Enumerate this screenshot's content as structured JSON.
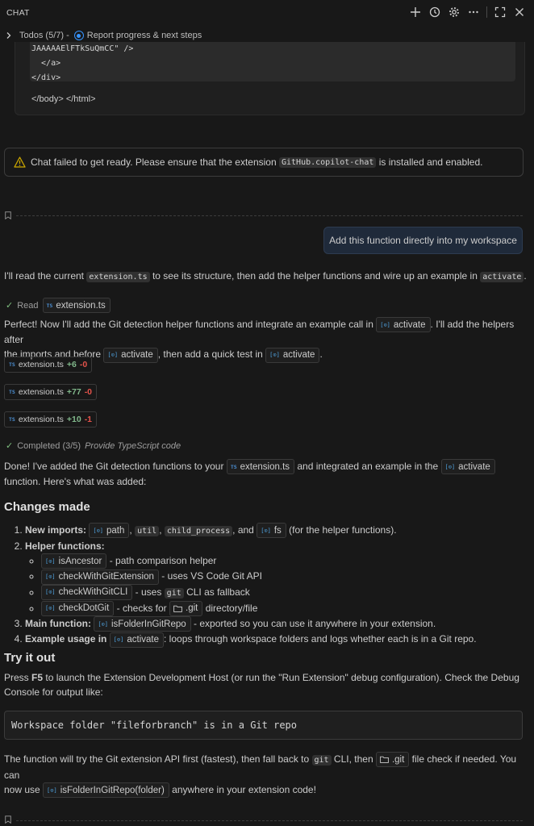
{
  "header": {
    "title": "CHAT"
  },
  "todos": {
    "label": "Todos (5/7) -",
    "current": "Report progress & next steps"
  },
  "code_snippet": {
    "lines": [
      "JAAAAAElFTkSuQmCC\" />",
      "  </a>",
      "</div>"
    ],
    "after": "</body> </html>"
  },
  "warning": {
    "text_before": "Chat failed to get ready. Please ensure that the extension",
    "code": "GitHub.copilot-chat",
    "text_after": "is installed and enabled."
  },
  "user_message": "Add this function directly into my workspace",
  "p1": {
    "a": "I'll read the current",
    "code1": "extension.ts",
    "b": "to see its structure, then add the helper functions and wire up an example in",
    "code2": "activate",
    "c": "."
  },
  "read_status": {
    "label": "Read",
    "file": "extension.ts"
  },
  "p2": {
    "a": "Perfect! Now I'll add the Git detection helper functions and integrate an example call in",
    "sym1": "activate",
    "b": ". I'll add the helpers after",
    "c": "the imports and before",
    "sym2": "activate",
    "d": ", then add a quick test in",
    "sym3": "activate",
    "e": "."
  },
  "edits": [
    {
      "file": "extension.ts",
      "added": "+6",
      "removed": "-0"
    },
    {
      "file": "extension.ts",
      "added": "+77",
      "removed": "-0"
    },
    {
      "file": "extension.ts",
      "added": "+10",
      "removed": "-1"
    }
  ],
  "completed_status": {
    "label": "Completed (3/5)",
    "task": "Provide TypeScript code"
  },
  "p3": {
    "a": "Done! I've added the Git detection functions to your",
    "file": "extension.ts",
    "b": "and integrated an example in the",
    "sym": "activate",
    "c": "function. Here's what was added:"
  },
  "changes": {
    "heading": "Changes made",
    "item1": {
      "label": "New imports:",
      "sym_path": "path",
      "comma1": ",",
      "code_util": "util",
      "comma2": ",",
      "code_cp": "child_process",
      "and": ", and",
      "sym_fs": "fs",
      "rest": "(for the helper functions)."
    },
    "item2": {
      "label": "Helper functions:",
      "subs": [
        {
          "sym": "isAncestor",
          "desc": "- path comparison helper"
        },
        {
          "sym": "checkWithGitExtension",
          "desc": "- uses VS Code Git API"
        },
        {
          "sym": "checkWithGitCLI",
          "desc_a": "- uses",
          "code": "git",
          "desc_b": "CLI as fallback"
        },
        {
          "sym": "checkDotGit",
          "desc_a": "- checks for",
          "folder": ".git",
          "desc_b": "directory/file"
        }
      ]
    },
    "item3": {
      "label": "Main function:",
      "sym": "isFolderInGitRepo",
      "rest": "- exported so you can use it anywhere in your extension."
    },
    "item4": {
      "label": "Example usage in",
      "sym": "activate",
      "rest": ": loops through workspace folders and logs whether each is in a Git repo."
    }
  },
  "try_it": {
    "heading": "Try it out",
    "a": "Press",
    "key": "F5",
    "b": "to launch the Extension Development Host (or run the \"Run Extension\" debug configuration). Check the Debug",
    "c": "Console for output like:"
  },
  "output_sample": "Workspace folder \"fileforbranch\" is in a Git repo",
  "final": {
    "a": "The function will try the Git extension API first (fastest), then fall back to",
    "code": "git",
    "b": "CLI, then",
    "folder": ".git",
    "c": "file check if needed. You can",
    "d": "now use",
    "sym": "isFolderInGitRepo(folder)",
    "e": "anywhere in your extension code!"
  },
  "icons": {
    "header": [
      "plus-icon",
      "history-icon",
      "gear-icon",
      "more-icon",
      "maximize-icon",
      "close-icon"
    ],
    "symbol_glyph": "[⊙]",
    "ts_glyph": "TS"
  },
  "colors": {
    "background": "#181818",
    "accent": "#3794ff",
    "added": "#81b88b",
    "removed": "#e5534b",
    "warning": "#cca700"
  }
}
